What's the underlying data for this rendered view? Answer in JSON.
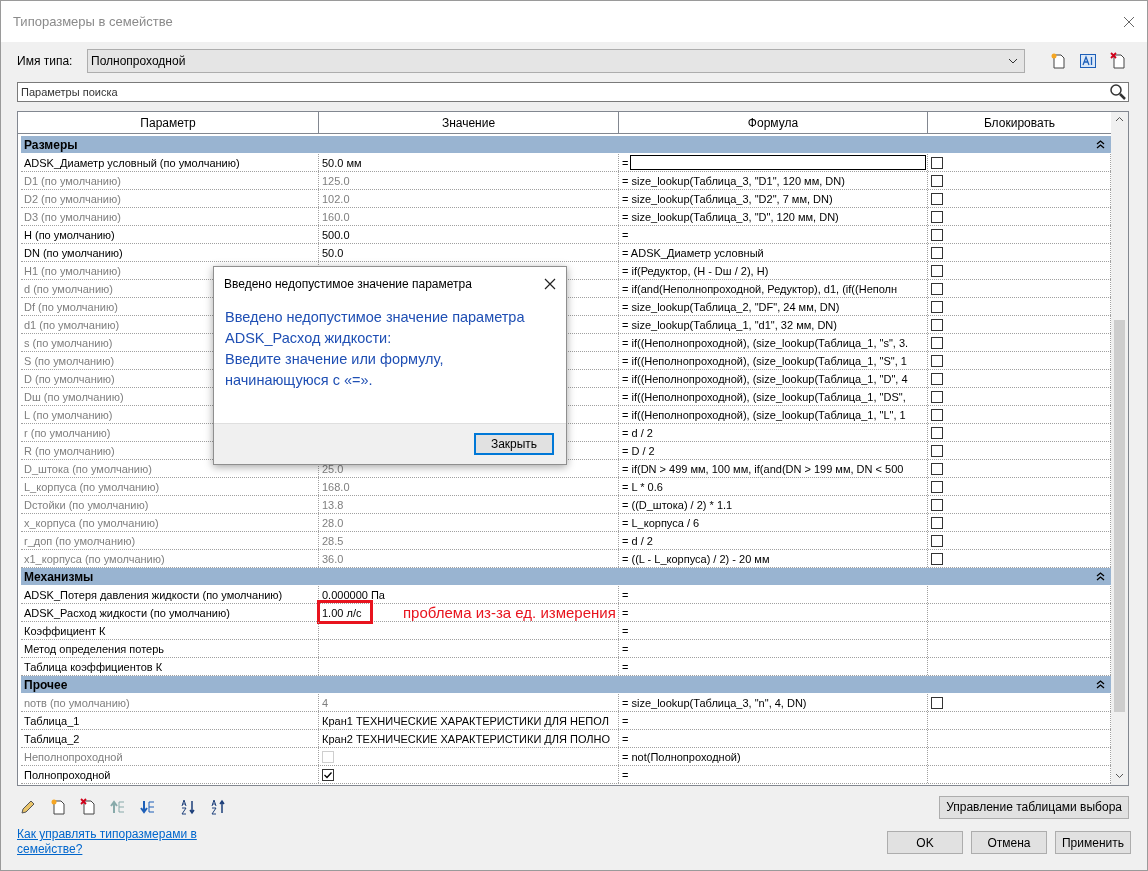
{
  "window": {
    "title": "Типоразмеры в семействе"
  },
  "type_name": {
    "label": "Имя типа:",
    "value": "Полнопроходной"
  },
  "search": {
    "placeholder": "Параметры поиска"
  },
  "table": {
    "columns": [
      "Параметр",
      "Значение",
      "Формула",
      "Блокировать"
    ],
    "groups": [
      {
        "name": "Размеры",
        "expanded": true,
        "rows": [
          {
            "name": "ADSK_Диаметр условный (по умолчанию)",
            "kind": "value",
            "value": "50.0 мм",
            "formula": "=",
            "editing": true,
            "greyed": false,
            "locked": false
          },
          {
            "name": "D1 (по умолчанию)",
            "kind": "value",
            "value": "125.0",
            "formula": "= size_lookup(Таблица_3, \"D1\", 120 мм, DN)",
            "editing": false,
            "greyed": true,
            "locked": false
          },
          {
            "name": "D2 (по умолчанию)",
            "kind": "value",
            "value": "102.0",
            "formula": "= size_lookup(Таблица_3, \"D2\", 7 мм, DN)",
            "editing": false,
            "greyed": true,
            "locked": false
          },
          {
            "name": "D3 (по умолчанию)",
            "kind": "value",
            "value": "160.0",
            "formula": "= size_lookup(Таблица_3, \"D\", 120 мм, DN)",
            "editing": false,
            "greyed": true,
            "locked": false
          },
          {
            "name": "H (по умолчанию)",
            "kind": "value",
            "value": "500.0",
            "formula": "=",
            "editing": false,
            "greyed": false,
            "locked": false
          },
          {
            "name": "DN (по умолчанию)",
            "kind": "value",
            "value": "50.0",
            "formula": "= ADSK_Диаметр условный",
            "editing": false,
            "greyed": false,
            "locked": false
          },
          {
            "name": "H1 (по умолчанию)",
            "kind": "value",
            "formula": "= if(Редуктор, (H - Dш / 2), H)",
            "editing": false,
            "greyed": true,
            "locked": false
          },
          {
            "name": "d (по умолчанию)",
            "kind": "value",
            "formula": "= if(and(Неполнопроходной, Редуктор), d1, (if((Неполн",
            "editing": false,
            "greyed": true,
            "locked": false
          },
          {
            "name": "Df (по умолчанию)",
            "kind": "value",
            "formula": "= size_lookup(Таблица_2, \"DF\", 24 мм, DN)",
            "editing": false,
            "greyed": true,
            "locked": false
          },
          {
            "name": "d1 (по умолчанию)",
            "kind": "value",
            "formula": "= size_lookup(Таблица_1, \"d1\", 32 мм, DN)",
            "editing": false,
            "greyed": true,
            "locked": false
          },
          {
            "name": "s (по умолчанию)",
            "kind": "value",
            "formula": "= if((Неполнопроходной), (size_lookup(Таблица_1, \"s\", 3.",
            "editing": false,
            "greyed": true,
            "locked": false
          },
          {
            "name": "S (по умолчанию)",
            "kind": "value",
            "formula": "= if((Неполнопроходной), (size_lookup(Таблица_1, \"S\", 1",
            "editing": false,
            "greyed": true,
            "locked": false
          },
          {
            "name": "D (по умолчанию)",
            "kind": "value",
            "formula": "= if((Неполнопроходной), (size_lookup(Таблица_1, \"D\", 4",
            "editing": false,
            "greyed": true,
            "locked": false
          },
          {
            "name": "Dш (по умолчанию)",
            "kind": "value",
            "formula": "= if((Неполнопроходной), (size_lookup(Таблица_1, \"DS\",",
            "editing": false,
            "greyed": true,
            "locked": false
          },
          {
            "name": "L (по умолчанию)",
            "kind": "value",
            "formula": "= if((Неполнопроходной), (size_lookup(Таблица_1, \"L\", 1",
            "editing": false,
            "greyed": true,
            "locked": false
          },
          {
            "name": "r (по умолчанию)",
            "kind": "value",
            "formula": "= d / 2",
            "editing": false,
            "greyed": true,
            "locked": false
          },
          {
            "name": "R (по умолчанию)",
            "kind": "value",
            "formula": "= D / 2",
            "editing": false,
            "greyed": true,
            "locked": false
          },
          {
            "name": "D_штока (по умолчанию)",
            "kind": "value",
            "value": "25.0",
            "formula": "= if(DN > 499 мм, 100 мм, if(and(DN > 199 мм, DN < 500",
            "editing": false,
            "greyed": true,
            "locked": false
          },
          {
            "name": "L_корпуса (по умолчанию)",
            "kind": "value",
            "value": "168.0",
            "formula": "= L * 0.6",
            "editing": false,
            "greyed": true,
            "locked": false
          },
          {
            "name": "Dстойки (по умолчанию)",
            "kind": "value",
            "value": "13.8",
            "formula": "= ((D_штока) / 2) * 1.1",
            "editing": false,
            "greyed": true,
            "locked": false
          },
          {
            "name": "x_корпуса (по умолчанию)",
            "kind": "value",
            "value": "28.0",
            "formula": "= L_корпуса / 6",
            "editing": false,
            "greyed": true,
            "locked": false
          },
          {
            "name": "r_доп (по умолчанию)",
            "kind": "value",
            "value": "28.5",
            "formula": "= d / 2",
            "editing": false,
            "greyed": true,
            "locked": false
          },
          {
            "name": "x1_корпуса (по умолчанию)",
            "kind": "value",
            "value": "36.0",
            "formula": "= ((L - L_корпуса) / 2) - 20 мм",
            "editing": false,
            "greyed": true,
            "locked": false
          }
        ]
      },
      {
        "name": "Механизмы",
        "expanded": true,
        "rows": [
          {
            "name": "ADSK_Потеря давления жидкости (по умолчанию)",
            "kind": "value",
            "value": "0.000000 Па",
            "formula": "=",
            "editing": false,
            "greyed": false
          },
          {
            "name": "ADSK_Расход жидкости (по умолчанию)",
            "kind": "value",
            "value": "1.00 л/с",
            "formula": "=",
            "editing": false,
            "greyed": false,
            "annotation": "проблема из-за ед. измерения"
          },
          {
            "name": "Коэффициент К",
            "kind": "value",
            "formula": "=",
            "editing": false,
            "greyed": false
          },
          {
            "name": "Метод определения потерь",
            "kind": "value",
            "formula": "=",
            "editing": false,
            "greyed": false
          },
          {
            "name": "Таблица коэффициентов К",
            "kind": "value",
            "formula": "=",
            "editing": false,
            "greyed": false
          }
        ]
      },
      {
        "name": "Прочее",
        "expanded": true,
        "rows": [
          {
            "name": "nотв (по умолчанию)",
            "kind": "value",
            "value": "4",
            "formula": "= size_lookup(Таблица_3, \"n\", 4, DN)",
            "editing": false,
            "greyed": true,
            "locked": false
          },
          {
            "name": "Таблица_1",
            "kind": "value",
            "value": "Кран1 ТЕХНИЧЕСКИЕ ХАРАКТЕРИСТИКИ ДЛЯ НЕПОЛ",
            "formula": "=",
            "editing": false,
            "greyed": false
          },
          {
            "name": "Таблица_2",
            "kind": "value",
            "value": "Кран2 ТЕХНИЧЕСКИЕ ХАРАКТЕРИСТИКИ ДЛЯ ПОЛНО",
            "formula": "=",
            "editing": false,
            "greyed": false
          },
          {
            "name": "Неполнопроходной",
            "kind": "flag",
            "checked": false,
            "formula": "= not(Полнопроходной)",
            "editing": false,
            "greyed": true
          },
          {
            "name": "Полнопроходной",
            "kind": "flag",
            "checked": true,
            "formula": "=",
            "editing": false,
            "greyed": false
          }
        ]
      }
    ]
  },
  "lookup_button": "Управление таблицами выбора",
  "help_link": "Как управлять типоразмерами в семействе?",
  "buttons": [
    "OK",
    "Отмена",
    "Применить"
  ],
  "dialog": {
    "title": "Введено недопустимое значение параметра",
    "message_lines": [
      "Введено недопустимое значение параметра",
      "ADSK_Расход жидкости:",
      "Введите значение или формулу,",
      "начинающуюся с «=»."
    ],
    "button": "Закрыть"
  }
}
